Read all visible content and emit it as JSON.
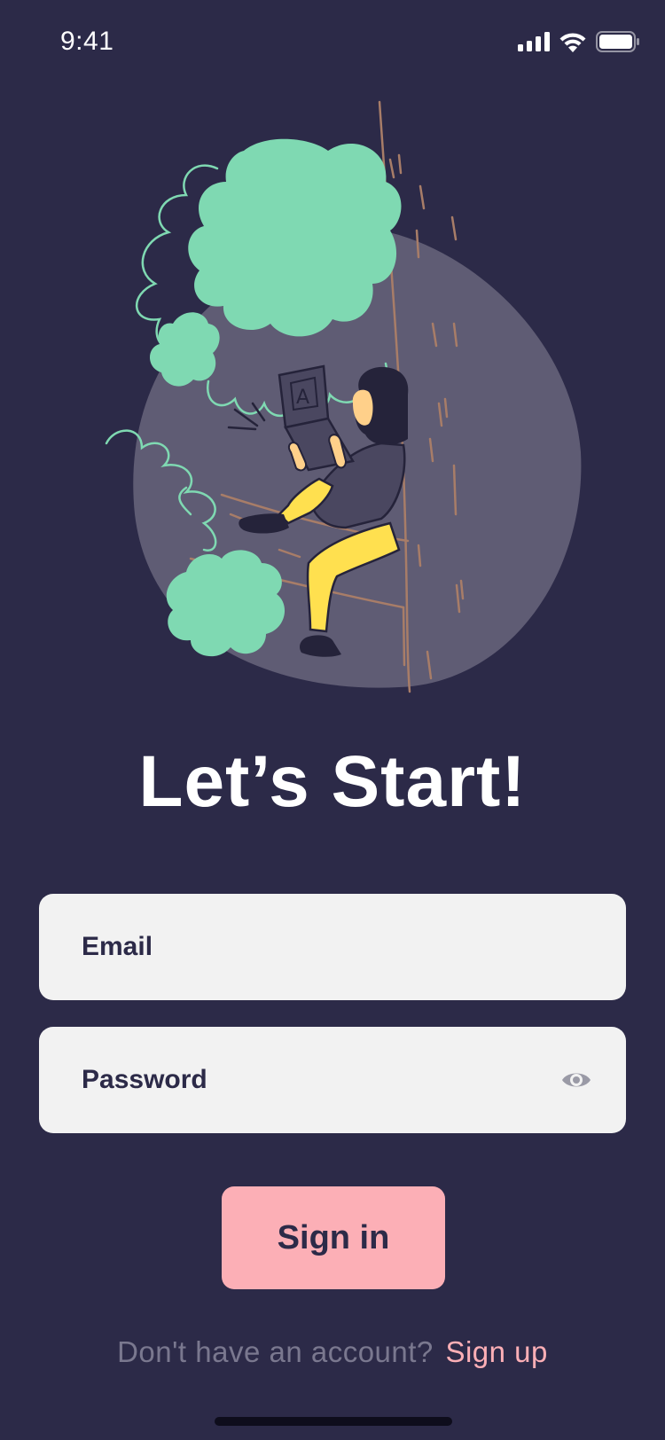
{
  "status_bar": {
    "time": "9:41",
    "signal_icon": "cellular-signal-icon",
    "wifi_icon": "wifi-icon",
    "battery_icon": "battery-icon"
  },
  "illustration": {
    "icon": "woman-with-laptop-climbing-tree-illustration",
    "laptop_letter": "A"
  },
  "title": "Let’s Start!",
  "form": {
    "email_placeholder": "Email",
    "email_value": "",
    "password_placeholder": "Password",
    "password_value": "",
    "password_toggle_icon": "eye-icon",
    "signin_label": "Sign in"
  },
  "footer": {
    "prompt": "Don't have an account?",
    "signup_label": "Sign up"
  },
  "colors": {
    "background": "#2c2a48",
    "accent_pink": "#fcafb6",
    "field_background": "#f2f2f2",
    "foliage_green": "#7fd9b2",
    "pants_yellow": "#ffe04f",
    "circle_gray": "#5f5c74",
    "muted_text": "#7a788f"
  }
}
